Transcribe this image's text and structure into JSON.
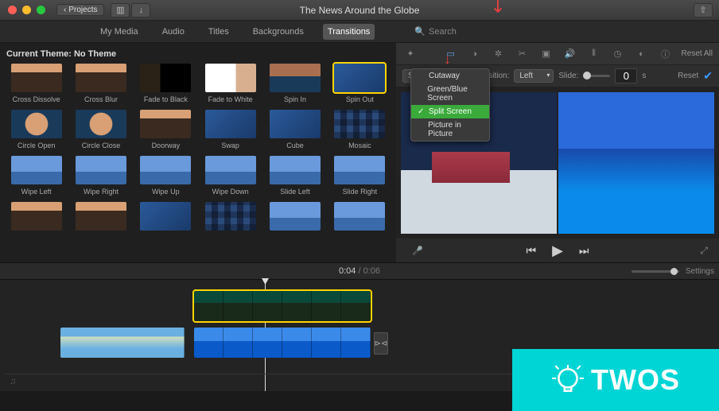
{
  "window": {
    "title": "The News Around the Globe",
    "back_label": "Projects"
  },
  "tabs": {
    "items": [
      "My Media",
      "Audio",
      "Titles",
      "Backgrounds",
      "Transitions"
    ],
    "active_index": 4
  },
  "search": {
    "placeholder": "Search"
  },
  "theme": {
    "label": "Current Theme: No Theme"
  },
  "transitions": [
    {
      "label": "Cross Dissolve",
      "style": "th-trees"
    },
    {
      "label": "Cross Blur",
      "style": "th-trees"
    },
    {
      "label": "Fade to Black",
      "style": "th-dark"
    },
    {
      "label": "Fade to White",
      "style": "th-light"
    },
    {
      "label": "Spin In",
      "style": "th-box"
    },
    {
      "label": "Spin Out",
      "style": "th-blue",
      "selected": true
    },
    {
      "label": "Circle Open",
      "style": "th-circle"
    },
    {
      "label": "Circle Close",
      "style": "th-circle"
    },
    {
      "label": "Doorway",
      "style": "th-trees"
    },
    {
      "label": "Swap",
      "style": "th-blue"
    },
    {
      "label": "Cube",
      "style": "th-blue"
    },
    {
      "label": "Mosaic",
      "style": "th-mosaic"
    },
    {
      "label": "Wipe Left",
      "style": "th-sky"
    },
    {
      "label": "Wipe Right",
      "style": "th-sky"
    },
    {
      "label": "Wipe Up",
      "style": "th-sky"
    },
    {
      "label": "Wipe Down",
      "style": "th-sky"
    },
    {
      "label": "Slide Left",
      "style": "th-sky"
    },
    {
      "label": "Slide Right",
      "style": "th-sky"
    },
    {
      "label": "",
      "style": "th-trees"
    },
    {
      "label": "",
      "style": "th-trees"
    },
    {
      "label": "",
      "style": "th-blue"
    },
    {
      "label": "",
      "style": "th-mosaic"
    },
    {
      "label": "",
      "style": "th-sky"
    },
    {
      "label": "",
      "style": "th-sky"
    }
  ],
  "inspector": {
    "reset_all": "Reset All"
  },
  "controls": {
    "overlay_mode": "Split Screen",
    "position_label": "Position:",
    "position_value": "Left",
    "slide_label": "Slide:",
    "slide_value": "0",
    "slide_unit": "s",
    "reset": "Reset"
  },
  "overlay_menu": {
    "items": [
      "Cutaway",
      "Green/Blue Screen",
      "Split Screen",
      "Picture in Picture"
    ],
    "selected_index": 2
  },
  "playback": {
    "current": "0:04",
    "total": "0:06"
  },
  "timeline": {
    "settings": "Settings"
  },
  "watermark": {
    "text": "TWOS"
  }
}
